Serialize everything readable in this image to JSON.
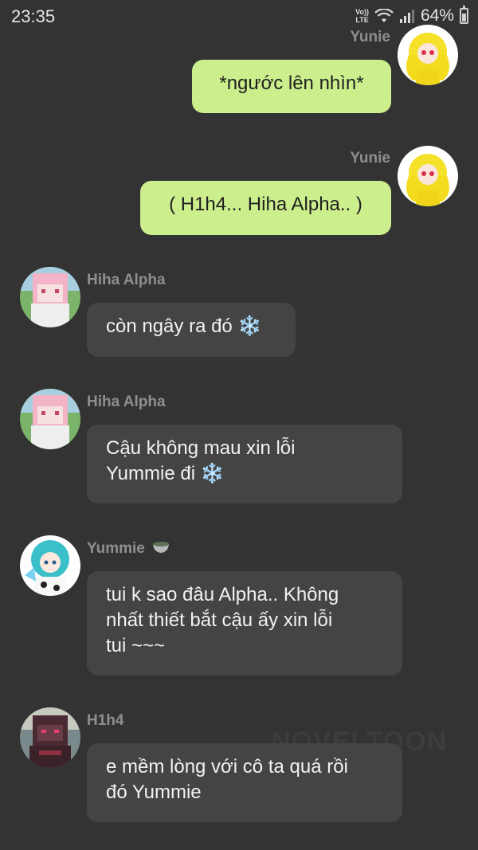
{
  "status_bar": {
    "time": "23:35",
    "volte_top": "Vo))",
    "volte_bottom": "LTE",
    "battery_percent": "64%",
    "battery_level": 0.64
  },
  "messages": [
    {
      "sender": "Yunie",
      "text": "*ngước lên nhìn*",
      "direction": "out",
      "avatar": "yellow-hair-avatar"
    },
    {
      "sender": "Yunie",
      "text": "( H1h4... Hiha Alpha.. )",
      "direction": "out",
      "avatar": "yellow-hair-avatar"
    },
    {
      "sender": "Hiha Alpha",
      "text": "còn ngây ra đó",
      "emoji": "❄️",
      "direction": "in",
      "avatar": "pink-hair-avatar"
    },
    {
      "sender": "Hiha Alpha",
      "text": "Cậu không mau xin lỗi\nYummie đi",
      "emoji": "❄️",
      "direction": "in",
      "avatar": "pink-hair-avatar"
    },
    {
      "sender": "Yummie",
      "sender_badge": "bowl-icon",
      "text": "tui k sao đâu Alpha.. Không\nnhất thiết bắt cậu ấy xin lỗi\ntui ~~~",
      "direction": "in",
      "avatar": "teal-hair-avatar"
    },
    {
      "sender": "H1h4",
      "text": "e mềm lòng với cô ta quá rồi\nđó Yummie",
      "direction": "in",
      "avatar": "dark-armor-avatar"
    }
  ],
  "watermark": "NOVELTOON",
  "colors": {
    "background": "#333333",
    "outgoing_bubble": "#ccee8d",
    "incoming_bubble": "#444444",
    "sender_name": "#8f8f8f"
  }
}
